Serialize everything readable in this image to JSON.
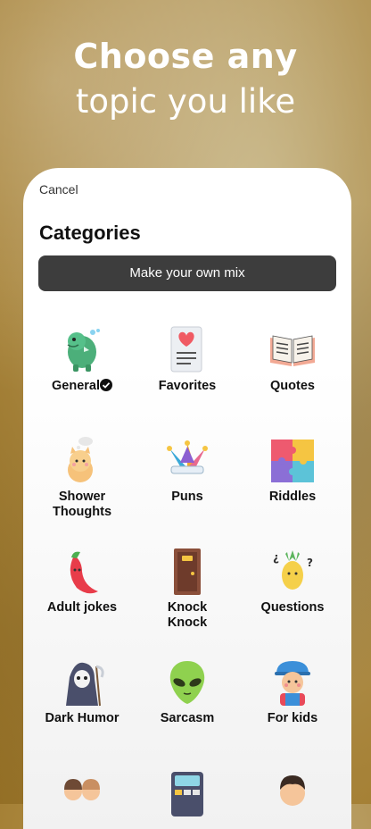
{
  "headline": {
    "line1": "Choose any",
    "line2": "topic you like"
  },
  "sheet": {
    "cancel_label": "Cancel",
    "title": "Categories",
    "mix_button_label": "Make your own mix"
  },
  "categories": [
    {
      "label": "General",
      "icon": "dinosaur-icon",
      "selected": true
    },
    {
      "label": "Favorites",
      "icon": "heart-note-icon"
    },
    {
      "label": "Quotes",
      "icon": "open-book-icon"
    },
    {
      "label": "Shower\nThoughts",
      "icon": "thinking-cat-icon"
    },
    {
      "label": "Puns",
      "icon": "jester-hat-icon"
    },
    {
      "label": "Riddles",
      "icon": "puzzle-icon"
    },
    {
      "label": "Adult jokes",
      "icon": "chili-pepper-icon"
    },
    {
      "label": "Knock\nKnock",
      "icon": "door-icon"
    },
    {
      "label": "Questions",
      "icon": "pineapple-icon"
    },
    {
      "label": "Dark Humor",
      "icon": "grim-reaper-icon"
    },
    {
      "label": "Sarcasm",
      "icon": "alien-icon"
    },
    {
      "label": "For kids",
      "icon": "kid-icon"
    }
  ]
}
